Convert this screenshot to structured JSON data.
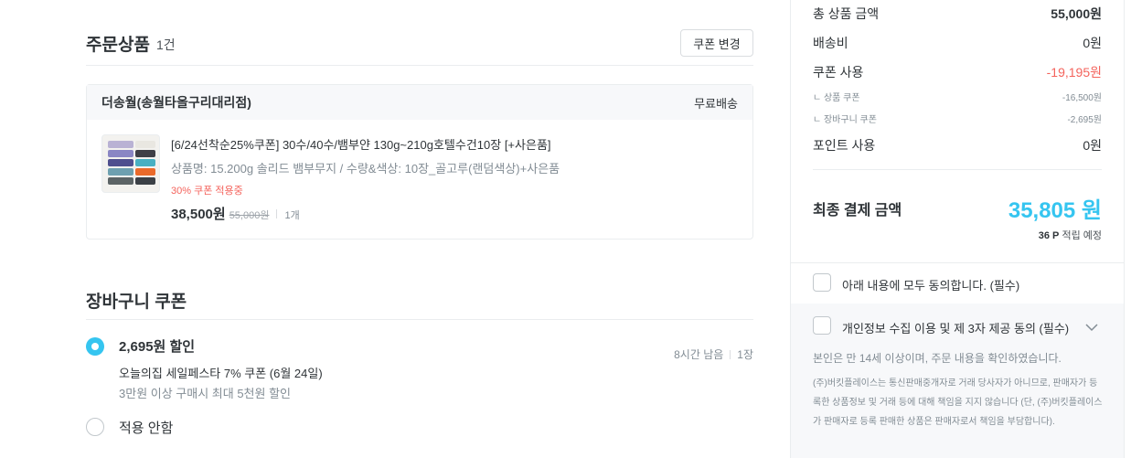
{
  "order": {
    "title": "주문상품",
    "count": "1건",
    "coupon_change_label": "쿠폰 변경",
    "store": {
      "name": "더송월(송월타올구리대리점)",
      "shipping": "무료배송"
    },
    "product": {
      "title": "[6/24선착순25%쿠폰] 30수/40수/뱀부얀 130g~210g호텔수건10장 [+사은품]",
      "option": "상품명: 15.200g 솔리드 뱀부무지 / 수량&색상: 10장_골고루(랜덤색상)+사은품",
      "coupon_applied": "30% 쿠폰 적용중",
      "price": "38,500원",
      "original_price": "55,000원",
      "quantity": "1개"
    }
  },
  "cart_coupon": {
    "title": "장바구니 쿠폰",
    "options": [
      {
        "amount": "2,695원 할인",
        "name": "오늘의집 세일페스타 7% 쿠폰 (6월 24일)",
        "condition": "3만원 이상 구매시 최대 5천원 할인",
        "time_left": "8시간 남음",
        "count": "1장",
        "selected": true
      },
      {
        "label": "적용 안함",
        "selected": false
      }
    ]
  },
  "summary": {
    "total_label": "총 상품 금액",
    "total_value": "55,000원",
    "shipping_label": "배송비",
    "shipping_value": "0원",
    "coupon_label": "쿠폰 사용",
    "coupon_value": "-19,195원",
    "product_coupon_label": "ㄴ 상품 쿠폰",
    "product_coupon_value": "-16,500원",
    "cart_coupon_label": "ㄴ 장바구니 쿠폰",
    "cart_coupon_value": "-2,695원",
    "point_label": "포인트 사용",
    "point_value": "0원",
    "final_label": "최종 결제 금액",
    "final_value": "35,805 원",
    "points_earn_value": "36 P",
    "points_earn_label": "적립 예정"
  },
  "agreements": {
    "all_label": "아래 내용에 모두 동의합니다. (필수)",
    "privacy_label": "개인정보 수집 이용 및 제 3자 제공 동의 (필수)",
    "age_text": "본인은 만 14세 이상이며, 주문 내용을 확인하였습니다.",
    "notice": "(주)버킷플레이스는 통신판매중개자로 거래 당사자가 아니므로, 판매자가 등록한 상품정보 및 거래 등에 대해 책임을 지지 않습니다 (단, (주)버킷플레이스가 판매자로 등록 판매한 상품은 판매자로서 책임을 부담합니다)."
  },
  "colors": {
    "accent": "#35c5f0",
    "discount_red": "#f4635c",
    "text": "#2f3438",
    "muted": "#828c94"
  }
}
